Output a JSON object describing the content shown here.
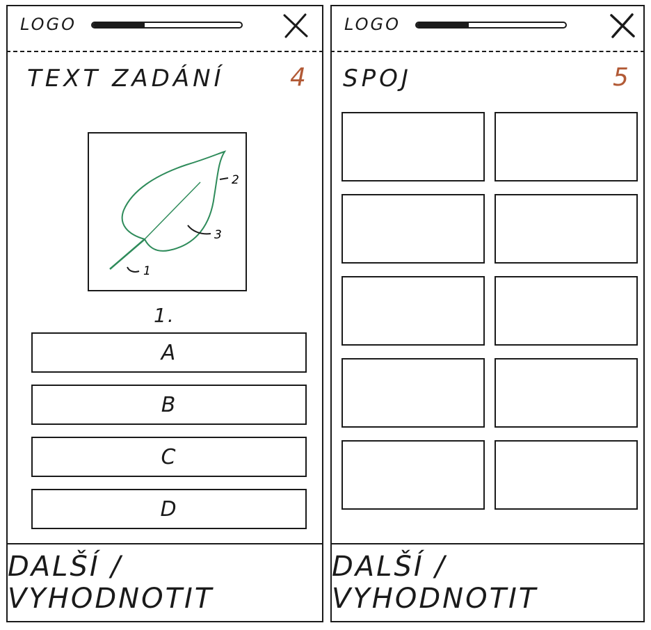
{
  "screens": [
    {
      "logo": "LOGO",
      "progress": 0.35,
      "title": "TEXT ZADÁNÍ",
      "page_number": "4",
      "figure": {
        "icon": "leaf-icon",
        "labels": [
          "1",
          "2",
          "3"
        ],
        "leaf_color": "#2e8b5a"
      },
      "question_number": "1.",
      "answers": [
        "A",
        "B",
        "C",
        "D"
      ],
      "next_label": "DALŠÍ / VYHODNOTIT"
    },
    {
      "logo": "LOGO",
      "progress": 0.35,
      "title": "SPOJ",
      "page_number": "5",
      "tiles": 10,
      "next_label": "DALŠÍ / VYHODNOTIT"
    }
  ],
  "colors": {
    "ink": "#1a1a1a",
    "accent": "#b25a36",
    "leaf": "#2e8b5a"
  }
}
